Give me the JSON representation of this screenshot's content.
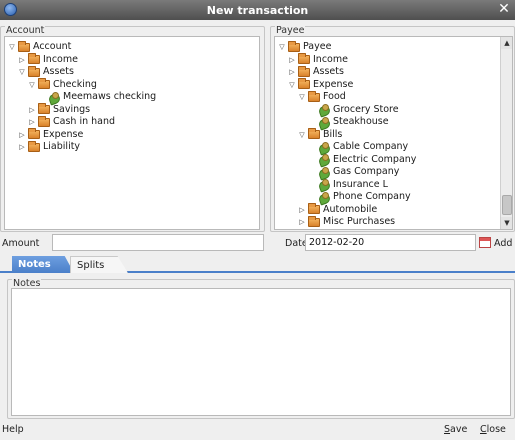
{
  "window": {
    "title": "New transaction",
    "close_glyph": "✕"
  },
  "account_panel": {
    "label": "Account",
    "tree": [
      {
        "label": "Account",
        "arrow": "▽",
        "icon": "folder"
      },
      {
        "label": "Income",
        "arrow": "▷",
        "icon": "folder"
      },
      {
        "label": "Assets",
        "arrow": "▽",
        "icon": "folder"
      },
      {
        "label": "Checking",
        "arrow": "▽",
        "icon": "folder"
      },
      {
        "label": "Meemaws checking",
        "arrow": "",
        "icon": "leaf"
      },
      {
        "label": "Savings",
        "arrow": "▷",
        "icon": "folder"
      },
      {
        "label": "Cash in hand",
        "arrow": "▷",
        "icon": "folder"
      },
      {
        "label": "Expense",
        "arrow": "▷",
        "icon": "folder"
      },
      {
        "label": "Liability",
        "arrow": "▷",
        "icon": "folder"
      }
    ]
  },
  "payee_panel": {
    "label": "Payee",
    "tree": [
      {
        "label": "Payee",
        "arrow": "▽",
        "icon": "folder"
      },
      {
        "label": "Income",
        "arrow": "▷",
        "icon": "folder"
      },
      {
        "label": "Assets",
        "arrow": "▷",
        "icon": "folder"
      },
      {
        "label": "Expense",
        "arrow": "▽",
        "icon": "folder"
      },
      {
        "label": "Food",
        "arrow": "▽",
        "icon": "folder"
      },
      {
        "label": "Grocery Store",
        "arrow": "",
        "icon": "leaf"
      },
      {
        "label": "Steakhouse",
        "arrow": "",
        "icon": "leaf"
      },
      {
        "label": "Bills",
        "arrow": "▽",
        "icon": "folder"
      },
      {
        "label": "Cable Company",
        "arrow": "",
        "icon": "leaf"
      },
      {
        "label": "Electric Company",
        "arrow": "",
        "icon": "leaf"
      },
      {
        "label": "Gas Company",
        "arrow": "",
        "icon": "leaf"
      },
      {
        "label": "Insurance L",
        "arrow": "",
        "icon": "leaf"
      },
      {
        "label": "Phone Company",
        "arrow": "",
        "icon": "leaf"
      },
      {
        "label": "Automobile",
        "arrow": "▷",
        "icon": "folder"
      },
      {
        "label": "Misc Purchases",
        "arrow": "▷",
        "icon": "folder"
      }
    ]
  },
  "amount": {
    "label": "Amount",
    "value": ""
  },
  "date": {
    "label": "Date",
    "value": "2012-02-20",
    "add_label": "Add"
  },
  "tabs": [
    {
      "label": "Notes",
      "active": true
    },
    {
      "label": "Splits",
      "active": false
    }
  ],
  "notes": {
    "label": "Notes",
    "value": ""
  },
  "buttons": {
    "help": "Help",
    "save_first": "S",
    "save_rest": "ave",
    "close_first": "C",
    "close_rest": "lose"
  },
  "colors": {
    "accent": "#4a7fc9",
    "folder": "#e89a44",
    "leaf": "#5fa83b"
  }
}
